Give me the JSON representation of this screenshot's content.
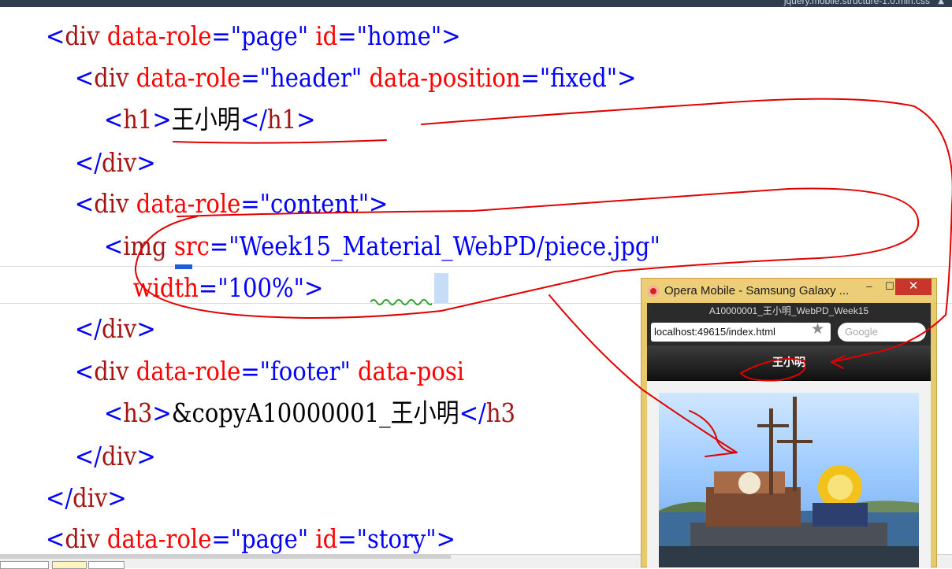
{
  "topbar": {
    "file_tab": "jquery.mobile.structure-1.0.min.css",
    "pin": "▲"
  },
  "code_lines": [
    [
      [
        "punc",
        "<"
      ],
      [
        "tag",
        "div"
      ],
      [
        "attr",
        " data-role"
      ],
      [
        "punc",
        "="
      ],
      [
        "val",
        "\"page\""
      ],
      [
        "attr",
        " id"
      ],
      [
        "punc",
        "="
      ],
      [
        "val",
        "\"home\""
      ],
      [
        "punc",
        ">"
      ]
    ],
    [
      [
        "punc",
        "    <"
      ],
      [
        "tag",
        "div"
      ],
      [
        "attr",
        " data-role"
      ],
      [
        "punc",
        "="
      ],
      [
        "val",
        "\"header\""
      ],
      [
        "attr",
        " data-position"
      ],
      [
        "punc",
        "="
      ],
      [
        "val",
        "\"fixed\""
      ],
      [
        "punc",
        ">"
      ]
    ],
    [
      [
        "punc",
        "        <"
      ],
      [
        "tag",
        "h1"
      ],
      [
        "punc",
        ">"
      ],
      [
        "txt",
        "王小明"
      ],
      [
        "punc",
        "</"
      ],
      [
        "tag",
        "h1"
      ],
      [
        "punc",
        ">"
      ]
    ],
    [
      [
        "punc",
        "    </"
      ],
      [
        "tag",
        "div"
      ],
      [
        "punc",
        ">"
      ]
    ],
    [
      [
        "punc",
        "    <"
      ],
      [
        "tag",
        "div"
      ],
      [
        "attr",
        " data-role"
      ],
      [
        "punc",
        "="
      ],
      [
        "val",
        "\"content\""
      ],
      [
        "punc",
        ">"
      ]
    ],
    [
      [
        "punc",
        "        <"
      ],
      [
        "tag",
        "img"
      ],
      [
        "attr",
        " src"
      ],
      [
        "punc",
        "="
      ],
      [
        "val",
        "\"Week15_Material_WebPD/piece.jpg\""
      ]
    ],
    [
      [
        "attr",
        "            width"
      ],
      [
        "punc",
        "="
      ],
      [
        "val",
        "\"100%\""
      ],
      [
        "punc",
        ">"
      ]
    ],
    [
      [
        "punc",
        "    </"
      ],
      [
        "tag",
        "div"
      ],
      [
        "punc",
        ">"
      ]
    ],
    [
      [
        "punc",
        "    <"
      ],
      [
        "tag",
        "div"
      ],
      [
        "attr",
        " data-role"
      ],
      [
        "punc",
        "="
      ],
      [
        "val",
        "\"footer\""
      ],
      [
        "attr",
        " data-posi"
      ]
    ],
    [
      [
        "punc",
        "        <"
      ],
      [
        "tag",
        "h3"
      ],
      [
        "punc",
        ">"
      ],
      [
        "txt",
        "&copyA10000001_王小明"
      ],
      [
        "punc",
        "</"
      ],
      [
        "tag",
        "h3"
      ]
    ],
    [
      [
        "punc",
        "    </"
      ],
      [
        "tag",
        "div"
      ],
      [
        "punc",
        ">"
      ]
    ],
    [
      [
        "punc",
        "</"
      ],
      [
        "tag",
        "div"
      ],
      [
        "punc",
        ">"
      ]
    ],
    [
      [
        "punc",
        "<"
      ],
      [
        "tag",
        "div"
      ],
      [
        "attr",
        " data-role"
      ],
      [
        "punc",
        "="
      ],
      [
        "val",
        "\"page\""
      ],
      [
        "attr",
        " id"
      ],
      [
        "punc",
        "="
      ],
      [
        "val",
        "\"story\""
      ],
      [
        "punc",
        ">"
      ]
    ]
  ],
  "emulator": {
    "window_title": "Opera Mobile - Samsung Galaxy ...",
    "page_title": "A10000001_王小明_WebPD_Week15",
    "url": "localhost:49615/index.html",
    "search_placeholder": "Google",
    "header_text": "王小明",
    "buttons": {
      "minimize": "–",
      "maximize": "☐",
      "close": "✕"
    }
  },
  "colors": {
    "punctuation": "#0000ff",
    "tag": "#a31515",
    "attribute": "#ff0000",
    "value": "#0000ff",
    "annotation": "#e00000",
    "emulator_frame": "#e9c86e"
  },
  "icons": [
    "opera-icon",
    "star-icon",
    "minimize-icon",
    "maximize-icon",
    "close-icon"
  ]
}
